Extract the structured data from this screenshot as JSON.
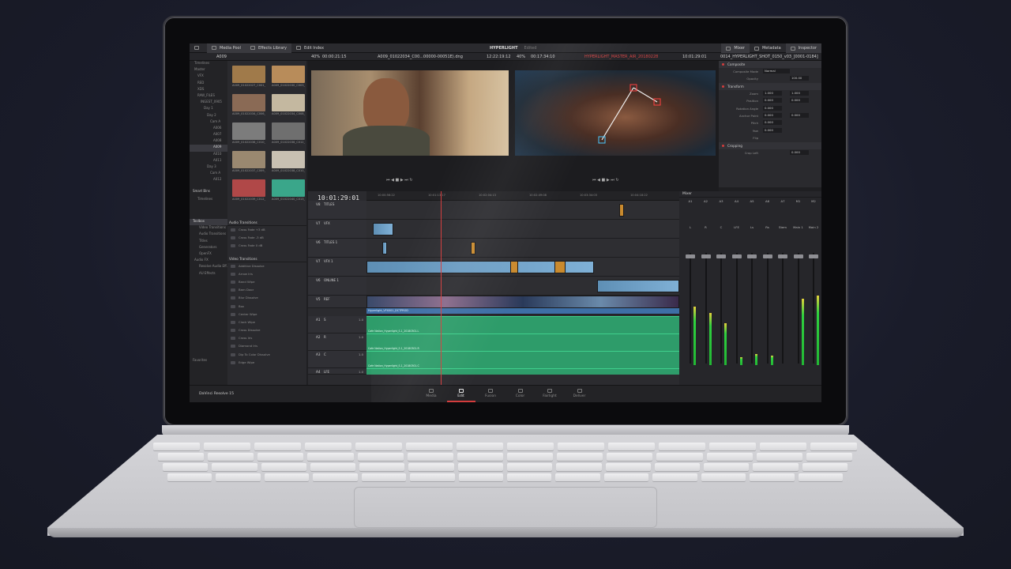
{
  "colors": {
    "accent": "#d43c3c",
    "video_clip": "#6e9fc5",
    "audio_clip": "#2e9c6a",
    "meter_green": "#22b734"
  },
  "topbar": {
    "media_pool": "Media Pool",
    "effects_library": "Effects Library",
    "edit_index": "Edit Index",
    "project_title": "HYPERLIGHT",
    "project_status": "Edited",
    "mixer": "Mixer",
    "metadata": "Metadata",
    "inspector": "Inspector"
  },
  "subbar": {
    "bin": "A009",
    "source_zoom": "40%",
    "source_timecode_in": "00:00:21:15",
    "source_clip": "A009_01022034_C00...00000-00051E).dng",
    "source_timecode": "12:22:19:12",
    "program_zoom": "40%",
    "program_duration": "00:17:34:10",
    "timeline_name": "HYPERLIGHT_MASTER_AIR_20180228",
    "program_timecode": "10:01:29:01",
    "inspector_clip": "0014_HYPERLIGHT_SHOT_0150_v03_[0001-0184]"
  },
  "tree": {
    "items": [
      "Timelines",
      "Master",
      "VFX",
      "RED",
      "XDS",
      "RAW_FILES",
      "INGEST_0905",
      "Day 1",
      "Day 2",
      "Cam A",
      "A006",
      "A007",
      "A008",
      "A009",
      "A010",
      "A011",
      "Day 3",
      "Cam A",
      "A012"
    ],
    "smart_bins": "Smart Bins",
    "timelines": "Timelines"
  },
  "clips": [
    "A009_01022027_C001_(0...",
    "A009_01022030_C003_(0...",
    "A009_01022034_C006_(0...",
    "A009_01022034_C008_(0...",
    "A009_01022036_C010_(0...",
    "A009_01022036_C012_(0...",
    "A009_01022037_C009_(0...",
    "A009_01022038_C010_(0...",
    "A009_01022039_C012_(0...",
    "A009_01022040_C013_(0..."
  ],
  "thumb_tones": [
    "#a07a4a",
    "#b88c5a",
    "#8a6a55",
    "#c4b8a0",
    "#7c7c7c",
    "#6f6f6f",
    "#9a8870",
    "#c8c0b2",
    "#b04848",
    "#3aa68a"
  ],
  "inspector": {
    "composite": "Composite",
    "composite_mode_label": "Composite Mode",
    "composite_mode": "Normal",
    "opacity_label": "Opacity",
    "opacity": "100.00",
    "transform": "Transform",
    "rows": [
      {
        "k": "Zoom",
        "x": "1.000",
        "y": "1.000"
      },
      {
        "k": "Position",
        "x": "0.000",
        "y": "0.000"
      },
      {
        "k": "Rotation Angle",
        "x": "0.000",
        "y": ""
      },
      {
        "k": "Anchor Point",
        "x": "0.000",
        "y": "0.000"
      },
      {
        "k": "Pitch",
        "x": "0.000",
        "y": ""
      },
      {
        "k": "Yaw",
        "x": "0.000",
        "y": ""
      },
      {
        "k": "Flip",
        "x": "",
        "y": ""
      }
    ],
    "cropping": "Cropping",
    "crop_left": "Crop Left",
    "crop_left_value": "0.000"
  },
  "toolbox": {
    "title": "Toolbox",
    "items": [
      "Video Transitions",
      "Audio Transitions",
      "Titles",
      "Generators",
      "OpenFX",
      "Audio FX",
      "Resolve Audio Eff...",
      "AU Effects"
    ],
    "favorites": "Favorites"
  },
  "fx": {
    "audio_transitions": "Audio Transitions",
    "audio_items": [
      "Cross Fade +3 dB",
      "Cross Fade -3 dB",
      "Cross Fade 0 dB"
    ],
    "video_transitions": "Video Transitions",
    "video_items": [
      "Additive Dissolve",
      "Arrow Iris",
      "Band Wipe",
      "Barn Door",
      "Blur Dissolve",
      "Box",
      "Center Wipe",
      "Clock Wipe",
      "Cross Dissolve",
      "Cross Iris",
      "Diamond Iris",
      "Dip To Color Dissolve",
      "Edge Wipe"
    ]
  },
  "timeline": {
    "timecode": "10:01:29:01",
    "ruler": [
      "10:00:56:22",
      "10:01:13:17",
      "10:02:04:13",
      "10:02:49:08",
      "10:03:34:03",
      "10:04:18:22"
    ],
    "video_tracks": [
      {
        "id": "V8",
        "name": "TITLES"
      },
      {
        "id": "V7",
        "name": "VFX"
      },
      {
        "id": "V6",
        "name": "TITLES 1"
      },
      {
        "id": "V7",
        "name": "VFX 1"
      },
      {
        "id": "V6",
        "name": "ONLINE 1"
      },
      {
        "id": "V5",
        "name": "REF"
      }
    ],
    "ref_clip": "Hyperlight_VFX001_DCTPROD",
    "audio_tracks": [
      {
        "id": "A1",
        "name": "S",
        "level": "1.0",
        "clip": "Cafe Nation_Hyperlight_S.1_20180301.L"
      },
      {
        "id": "A2",
        "name": "R",
        "level": "1.0",
        "clip": "Cafe Nation_Hyperlight_S.1_20180301.R"
      },
      {
        "id": "A3",
        "name": "C",
        "level": "1.0",
        "clip": "Cafe Nation_Hyperlight_S.1_20180301.C"
      },
      {
        "id": "A4",
        "name": "LFE",
        "level": "1.0",
        "clip": ""
      }
    ]
  },
  "mixer": {
    "title": "Mixer",
    "channels": [
      {
        "bus": "A1",
        "label": "L",
        "level": 0.62
      },
      {
        "bus": "A2",
        "label": "R",
        "level": 0.55
      },
      {
        "bus": "A3",
        "label": "C",
        "level": 0.44
      },
      {
        "bus": "A4",
        "label": "LFE",
        "level": 0.08
      },
      {
        "bus": "A5",
        "label": "Ls",
        "level": 0.12
      },
      {
        "bus": "A6",
        "label": "Rs",
        "level": 0.1
      },
      {
        "bus": "A7",
        "label": "Stem",
        "level": 0.0
      },
      {
        "bus": "M1",
        "label": "Main 1",
        "level": 0.7
      },
      {
        "bus": "M2",
        "label": "Main 2",
        "level": 0.73
      }
    ]
  },
  "pages": [
    "Media",
    "Edit",
    "Fusion",
    "Color",
    "Fairlight",
    "Deliver"
  ],
  "active_page": "Edit",
  "brand": "DaVinci Resolve 15"
}
